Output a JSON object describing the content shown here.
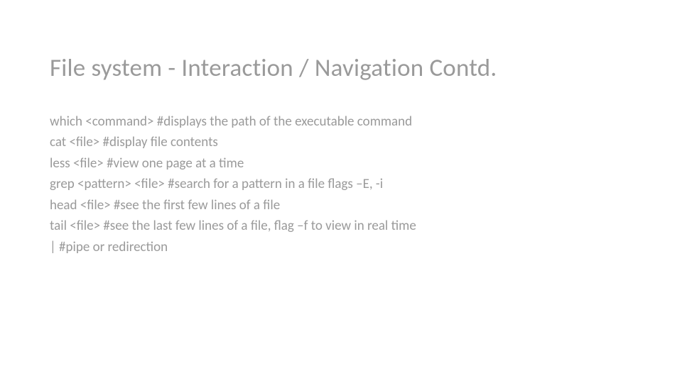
{
  "slide": {
    "title": "File system - Interaction / Navigation Contd.",
    "lines": [
      "which <command> #displays the path of the executable command",
      "cat <file>    #display file contents",
      "less <file>    #view one page at a time",
      "grep <pattern> <file>    #search for a pattern in a file flags –E, -i",
      "head <file>   #see the first few lines of a file",
      "tail <file>    #see the last few lines of a file, flag –f to view in real time",
      "|    #pipe or redirection"
    ]
  }
}
